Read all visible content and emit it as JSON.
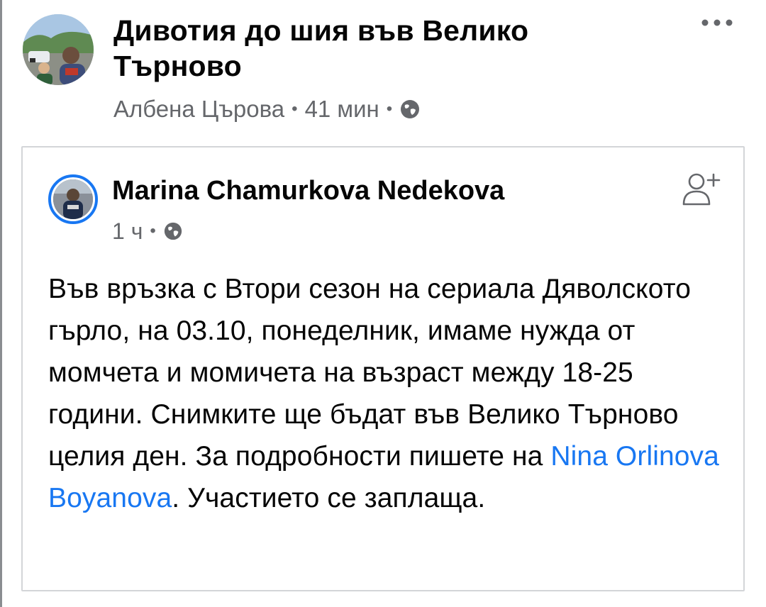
{
  "group": {
    "title": "Дивотия до шия във Велико Търново",
    "author": "Албена Църова",
    "time": "41 мин",
    "separator": "•"
  },
  "shared_post": {
    "author": "Marina Chamurkova Nedekova",
    "time": "1 ч",
    "separator": "•",
    "text_before": "Във връзка с Втори сезон на сериала Дяволското гърло, на 03.10,  понеделник, имаме нужда от момчета и момичета на възраст между 18-25 години. Снимките ще бъдат във Велико Търново целия ден. За подробности пишете на ",
    "mention": "Nina Orlinova Boyanova",
    "text_after": ". Участието се заплаща."
  },
  "icons": {
    "more": "more-horizontal-icon",
    "globe": "globe-icon",
    "follow": "add-friend-icon"
  },
  "colors": {
    "link": "#1877f2",
    "meta": "#65676b",
    "text": "#050505",
    "border": "#d3d5d8"
  }
}
